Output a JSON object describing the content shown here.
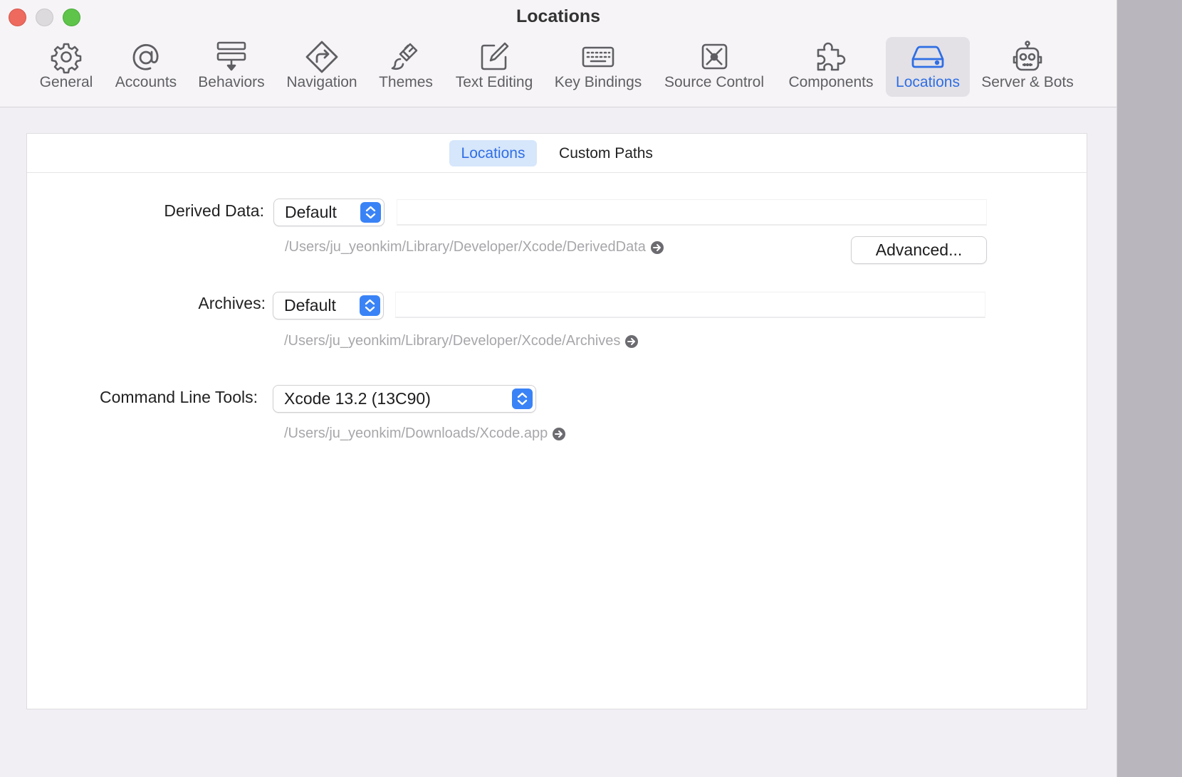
{
  "window": {
    "title": "Locations"
  },
  "toolbar": {
    "items": [
      {
        "label": "General",
        "icon": "gear-icon"
      },
      {
        "label": "Accounts",
        "icon": "at-sign-icon"
      },
      {
        "label": "Behaviors",
        "icon": "behaviors-icon"
      },
      {
        "label": "Navigation",
        "icon": "navigation-sign-icon"
      },
      {
        "label": "Themes",
        "icon": "paintbrush-icon"
      },
      {
        "label": "Text Editing",
        "icon": "pencil-square-icon"
      },
      {
        "label": "Key Bindings",
        "icon": "keyboard-icon"
      },
      {
        "label": "Source Control",
        "icon": "source-control-icon"
      },
      {
        "label": "Components",
        "icon": "puzzle-icon"
      },
      {
        "label": "Locations",
        "icon": "drive-icon"
      },
      {
        "label": "Server & Bots",
        "icon": "robot-icon"
      }
    ],
    "active": "Locations",
    "accent_color": "#2f6ee4"
  },
  "tabs": {
    "items": [
      "Locations",
      "Custom Paths"
    ],
    "active": "Locations"
  },
  "derived_data": {
    "label": "Derived Data:",
    "selected": "Default",
    "custom_value": "",
    "path": "/Users/ju_yeonkim/Library/Developer/Xcode/DerivedData",
    "advanced_label": "Advanced..."
  },
  "archives": {
    "label": "Archives:",
    "selected": "Default",
    "custom_value": "",
    "path": "/Users/ju_yeonkim/Library/Developer/Xcode/Archives"
  },
  "command_line_tools": {
    "label": "Command Line Tools:",
    "selected": "Xcode 13.2 (13C90)",
    "path": "/Users/ju_yeonkim/Downloads/Xcode.app"
  }
}
